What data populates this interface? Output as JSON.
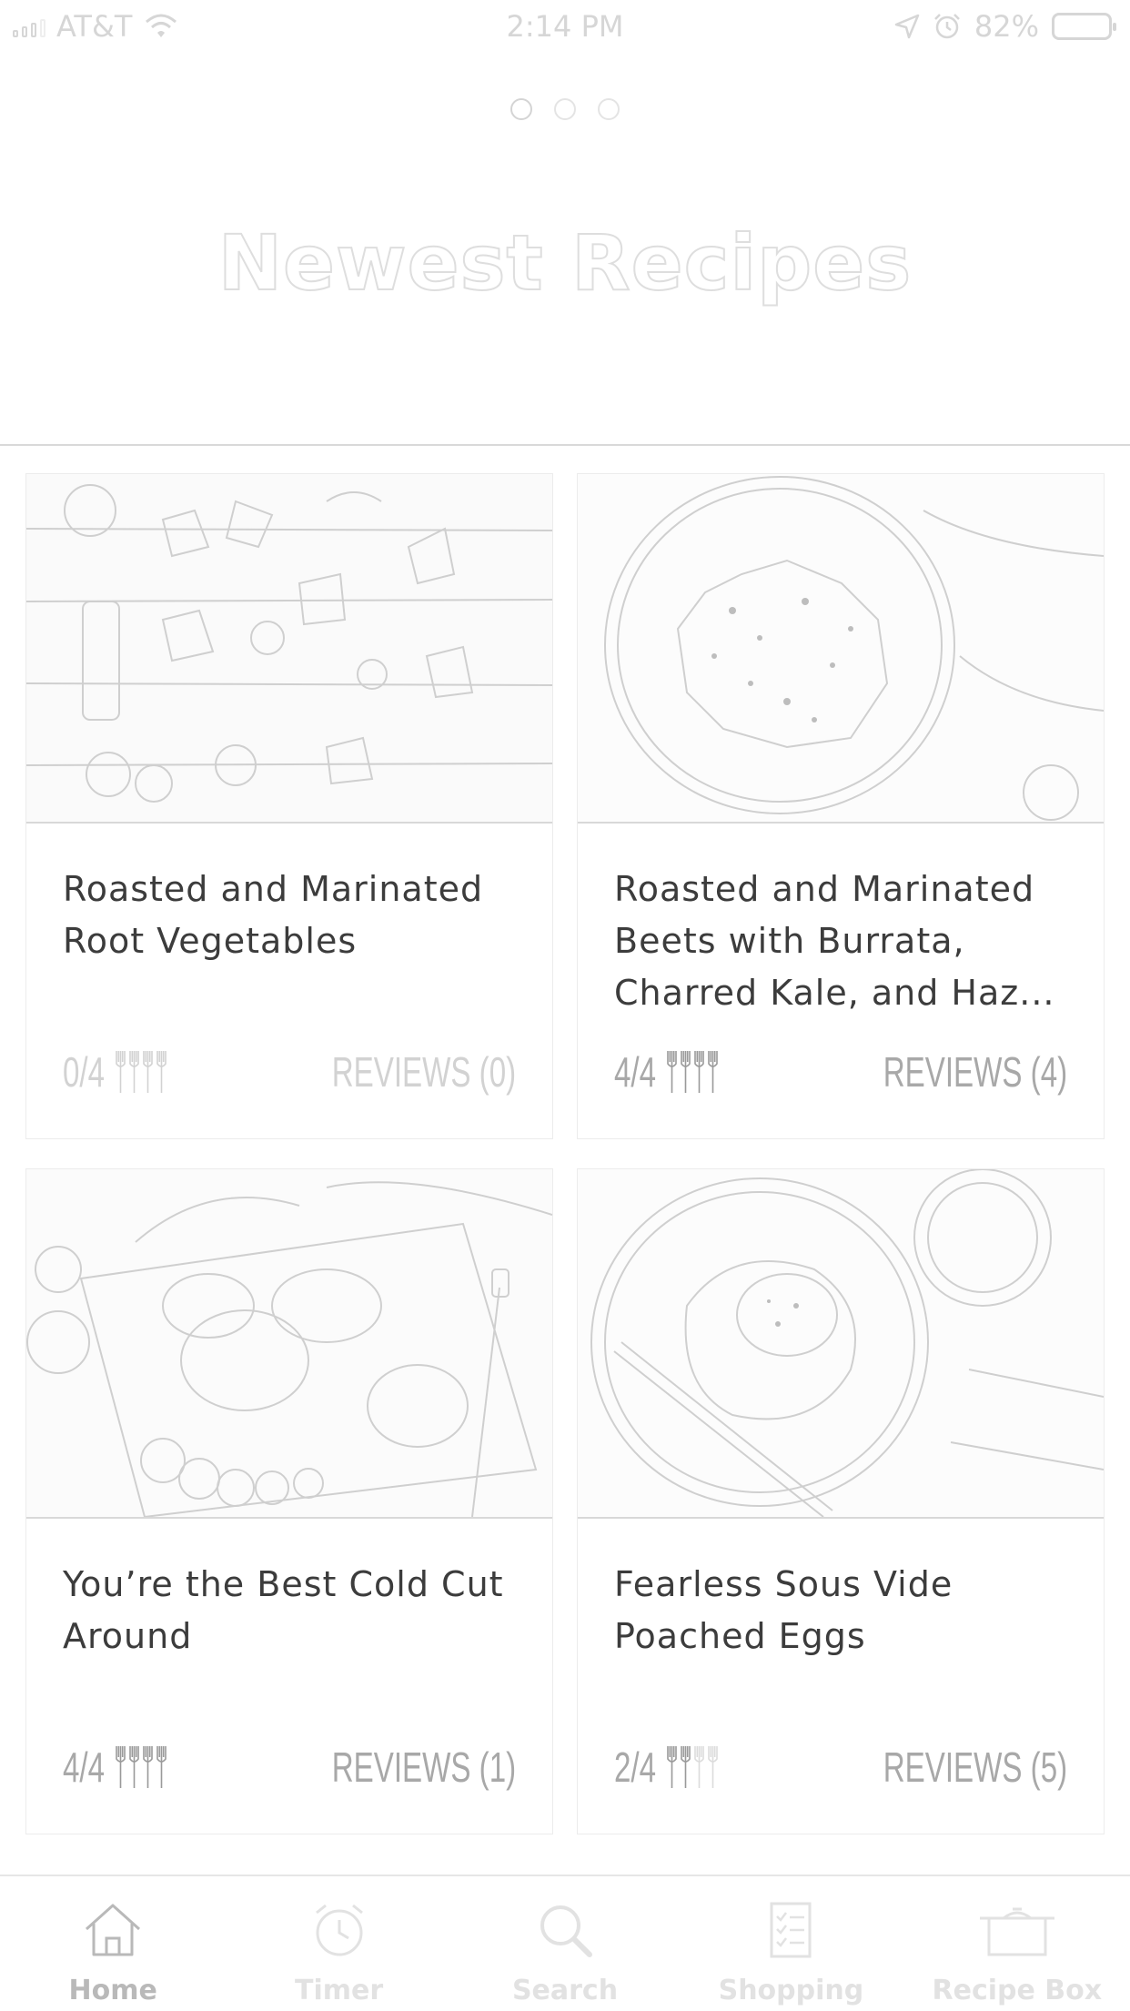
{
  "status_bar": {
    "carrier": "AT&T",
    "time": "2:14 PM",
    "battery": "82%"
  },
  "header": {
    "title": "Newest Recipes",
    "pages": 3,
    "active_page": 1
  },
  "recipes": [
    {
      "title": "Roasted and Marinated Root Vegetables",
      "rating": "0/4",
      "rating_value": 0,
      "reviews": "REVIEWS (0)",
      "image": "root-vegetables-photo"
    },
    {
      "title": "Roasted and Marinated Beets with Burrata, Charred Kale, and Haz...",
      "rating": "4/4",
      "rating_value": 4,
      "reviews": "REVIEWS (4)",
      "image": "beets-plate-photo"
    },
    {
      "title": "You’re the Best Cold Cut Around",
      "rating": "4/4",
      "rating_value": 4,
      "reviews": "REVIEWS (1)",
      "image": "cold-cut-board-photo"
    },
    {
      "title": "Fearless Sous Vide Poached Eggs",
      "rating": "2/4",
      "rating_value": 2,
      "reviews": "REVIEWS (5)",
      "image": "poached-eggs-photo"
    }
  ],
  "tabs": [
    {
      "label": "Home",
      "icon": "home-icon",
      "active": true
    },
    {
      "label": "Timer",
      "icon": "timer-icon",
      "active": false
    },
    {
      "label": "Search",
      "icon": "search-icon",
      "active": false
    },
    {
      "label": "Shopping",
      "icon": "shopping-list-icon",
      "active": false
    },
    {
      "label": "Recipe Box",
      "icon": "pot-icon",
      "active": false
    }
  ],
  "colors": {
    "text": "#3c3c3c",
    "muted": "#a8a8a8",
    "inactive_tab": "#e2e2e2",
    "active_tab": "#b9b9b9"
  }
}
